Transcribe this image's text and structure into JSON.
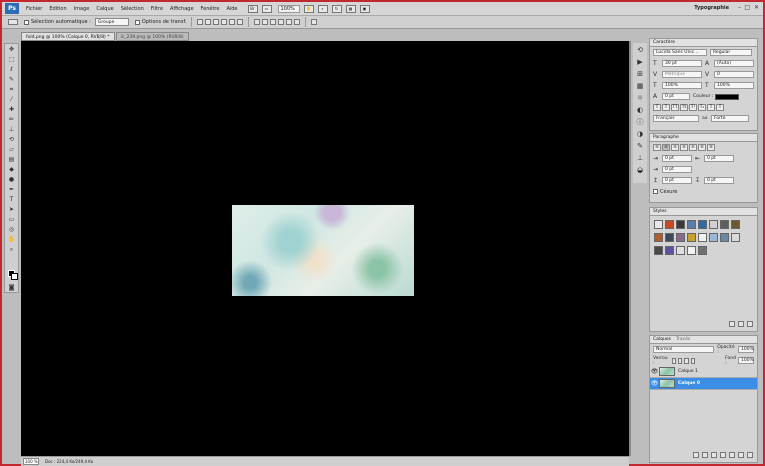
{
  "menu": {
    "logo": "Ps",
    "items": [
      "Fichier",
      "Edition",
      "Image",
      "Calque",
      "Sélection",
      "Filtre",
      "Affichage",
      "Fenêtre",
      "Aide"
    ],
    "zoom": "100%",
    "workspace": "Typographie",
    "window_controls": [
      "–",
      "□",
      "✕"
    ]
  },
  "options": {
    "auto_select_label": "Sélection automatique :",
    "auto_select_value": "Groupe",
    "transform_label": "Options de transf."
  },
  "tabs": [
    {
      "label": "fold.png @ 100% (Calque 0, RVB/8) *",
      "active": true
    },
    {
      "label": "ic_239.png @ 100% (RVB/8)",
      "active": false
    }
  ],
  "status": {
    "zoom": "100 %",
    "doc": "Doc : 224,4 Ko/249,4 Ko"
  },
  "character": {
    "tab": "Caractère",
    "font": "Lucida Sans Unic...",
    "style": "Regular",
    "size": "30 pt",
    "leading": "(Auto)",
    "kerning": "Métrique",
    "tracking": "0",
    "vscale": "100%",
    "hscale": "100%",
    "baseline": "0 pt",
    "color_label": "Couleur :",
    "language": "Français",
    "antialias": "Forte"
  },
  "paragraph": {
    "tab": "Paragraphe",
    "indent_left": "0 pt",
    "indent_right": "0 pt",
    "indent_first": "0 pt",
    "space_before": "0 pt",
    "space_after": "0 pt",
    "hyphenate": "Césure"
  },
  "styles": {
    "tab": "Styles",
    "swatches": [
      "#e8e8e8",
      "#c84820",
      "#3a3a3a",
      "#5a7ea8",
      "#2e6aa6",
      "#d0d0d0",
      "#5e5e5e",
      "#6a5a30",
      "#b06030",
      "#3e4a5a",
      "#8a6a8a",
      "#c8a030",
      "#f0f0f0",
      "#9ab8d8",
      "#6888a8",
      "#dadada",
      "#4a4a4a",
      "#6050a0",
      "#e0e0e0",
      "#f2f2f2",
      "#707070"
    ]
  },
  "layers": {
    "tabs": [
      "Calques",
      "Tracés"
    ],
    "blend": "Normal",
    "opacity_label": "Opacité :",
    "opacity": "100%",
    "lock_label": "Verrou :",
    "fill_label": "Fond :",
    "fill": "100%",
    "items": [
      {
        "name": "Calque 1",
        "selected": false
      },
      {
        "name": "Calque 0",
        "selected": true
      }
    ]
  }
}
